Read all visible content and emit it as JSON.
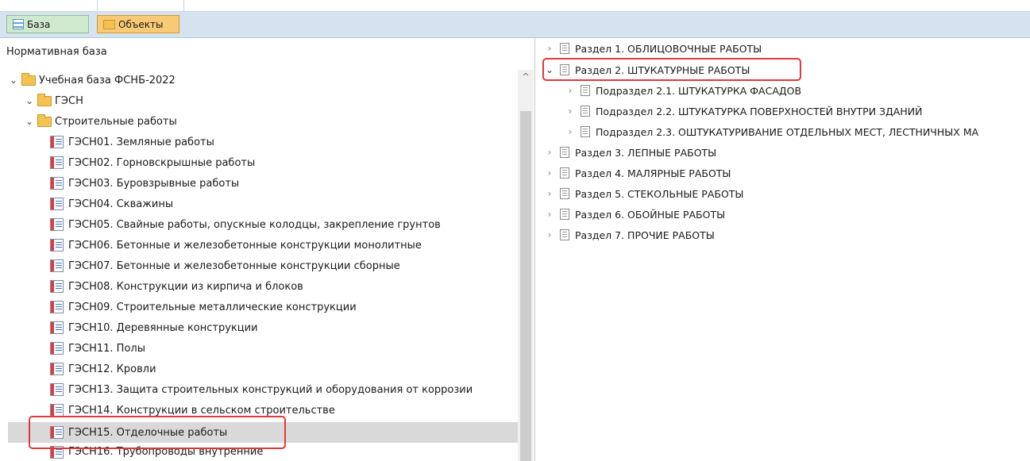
{
  "toolbar": {
    "base_label": "База",
    "objects_label": "Объекты"
  },
  "left_panel": {
    "title": "Нормативная база",
    "root": "Учебная база ФСНБ-2022",
    "group": "ГЭСН",
    "subgroup": "Строительные работы",
    "items": [
      "ГЭСН01. Земляные работы",
      "ГЭСН02. Горновскрышные работы",
      "ГЭСН03. Буровзрывные работы",
      "ГЭСН04. Скважины",
      "ГЭСН05. Свайные работы, опускные колодцы, закрепление грунтов",
      "ГЭСН06. Бетонные и железобетонные конструкции монолитные",
      "ГЭСН07. Бетонные и железобетонные конструкции сборные",
      "ГЭСН08. Конструкции из кирпича и блоков",
      "ГЭСН09. Строительные металлические конструкции",
      "ГЭСН10. Деревянные конструкции",
      "ГЭСН11. Полы",
      "ГЭСН12. Кровли",
      "ГЭСН13. Защита строительных конструкций и оборудования от коррозии",
      "ГЭСН14. Конструкции в сельском строительстве",
      "ГЭСН15. Отделочные работы",
      "ГЭСН16. Трубопроводы внутренние"
    ]
  },
  "right_panel": {
    "items": [
      "Раздел 1. ОБЛИЦОВОЧНЫЕ РАБОТЫ",
      "Раздел 2. ШТУКАТУРНЫЕ РАБОТЫ",
      "Подраздел 2.1. ШТУКАТУРКА ФАСАДОВ",
      "Подраздел 2.2. ШТУКАТУРКА ПОВЕРХНОСТЕЙ ВНУТРИ ЗДАНИЙ",
      "Подраздел 2.3. ОШТУКАТУРИВАНИЕ ОТДЕЛЬНЫХ МЕСТ, ЛЕСТНИЧНЫХ МА",
      "Раздел 3. ЛЕПНЫЕ РАБОТЫ",
      "Раздел 4. МАЛЯРНЫЕ РАБОТЫ",
      "Раздел 5. СТЕКОЛЬНЫЕ РАБОТЫ",
      "Раздел 6. ОБОЙНЫЕ РАБОТЫ",
      "Раздел 7. ПРОЧИЕ РАБОТЫ"
    ]
  },
  "icons": {
    "expand_collapsed": "›",
    "expand_open": "⌄",
    "scroll_up": "^"
  },
  "colors": {
    "highlight_border": "#e0383a",
    "selection": "#d9d9d9"
  }
}
